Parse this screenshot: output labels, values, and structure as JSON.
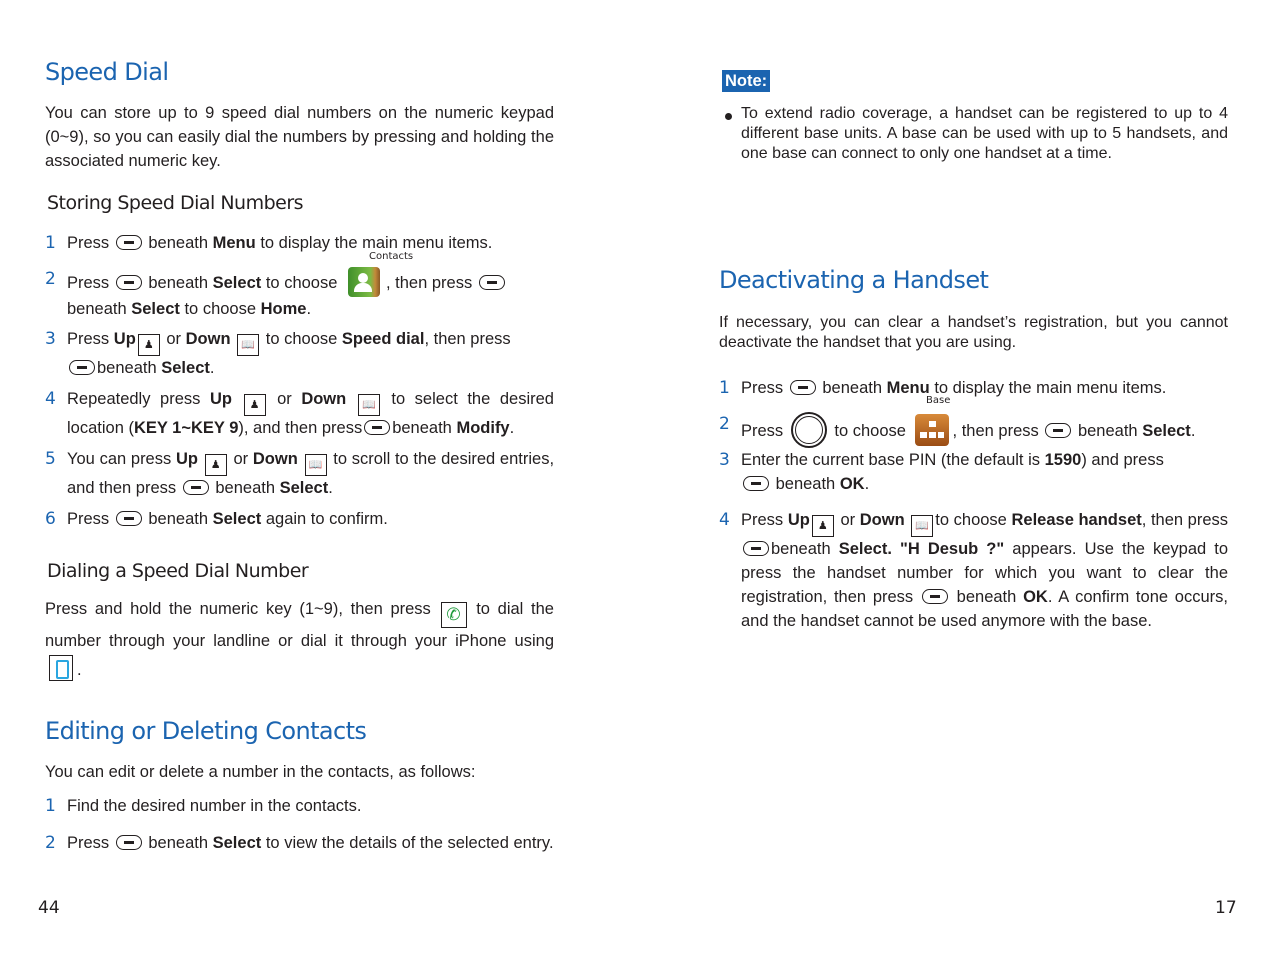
{
  "left_page": {
    "page_number": "44",
    "speed_dial": {
      "title": "Speed Dial",
      "intro": "You can store up to 9 speed dial numbers on the numeric keypad (0~9), so you can easily dial the numbers by pressing and holding the associated numeric key."
    },
    "storing": {
      "title": "Storing Speed Dial Numbers",
      "steps": [
        {
          "n": "1",
          "parts": [
            "Press",
            "beneath",
            "Menu",
            "to display the main menu items."
          ]
        },
        {
          "n": "2",
          "parts": [
            "Press",
            "beneath",
            "Select",
            "to choose",
            ", then press",
            "beneath",
            "Select",
            "to choose",
            "Home",
            "."
          ],
          "icon_caption": "Contacts"
        },
        {
          "n": "3",
          "parts": [
            "Press",
            "Up",
            "or",
            "Down",
            "to choose",
            "Speed dial",
            ", then press",
            "beneath",
            "Select",
            "."
          ]
        },
        {
          "n": "4",
          "parts": [
            "Repeatedly press",
            "Up",
            "or",
            "Down",
            "to select the desired location (",
            "KEY 1~KEY 9",
            "), and then press",
            "beneath",
            "Modify",
            "."
          ]
        },
        {
          "n": "5",
          "parts": [
            "You can press",
            "Up",
            "or",
            "Down",
            "to scroll to the desired entries, and then press",
            "beneath",
            "Select",
            "."
          ]
        },
        {
          "n": "6",
          "parts": [
            "Press",
            "beneath",
            "Select",
            "again to confirm."
          ]
        }
      ]
    },
    "dialing": {
      "title": "Dialing a Speed Dial Number",
      "parts": [
        "Press and hold the numeric key (1~9), then press",
        "to dial the number through your landline or dial it through your iPhone using",
        "."
      ]
    },
    "editing": {
      "title": "Editing or Deleting Contacts",
      "intro": "You can edit or delete a number in the contacts, as follows:",
      "steps": [
        {
          "n": "1",
          "parts": [
            "Find the desired number in the contacts."
          ]
        },
        {
          "n": "2",
          "parts": [
            "Press",
            "beneath",
            "Select",
            "to view the details of the selected entry."
          ]
        }
      ]
    }
  },
  "right_page": {
    "page_number": "17",
    "note": {
      "label": "Note:",
      "text": "To extend radio coverage, a handset can be registered to up to 4 different base units. A base can be used with up to 5 handsets, and one base can connect to only one handset at a time."
    },
    "deactivating": {
      "title": "Deactivating a Handset",
      "intro": "If necessary, you can clear a handset’s registration, but you cannot deactivate the handset that you are using.",
      "steps": [
        {
          "n": "1",
          "parts": [
            "Press",
            "beneath",
            "Menu",
            "to display the main menu items."
          ]
        },
        {
          "n": "2",
          "parts": [
            "Press",
            "to choose",
            ", then press",
            "beneath",
            "Select",
            "."
          ],
          "icon_caption": "Base"
        },
        {
          "n": "3",
          "parts": [
            "Enter the current base PIN (the default is",
            "1590",
            ") and press",
            "beneath",
            "OK",
            "."
          ]
        },
        {
          "n": "4",
          "parts": [
            "Press",
            "Up",
            "or",
            "Down",
            "to choose",
            "Release handset",
            ", then press",
            "beneath",
            "Select",
            ". \"H Desub ?\"",
            "appears. Use the keypad to press the handset number for which you want to clear the registration, then press",
            "beneath",
            "OK",
            ". A confirm tone occurs, and the handset cannot be used anymore with the base."
          ]
        }
      ]
    }
  },
  "icons": {
    "up_key": "contacts-up-key-icon",
    "down_key": "phonebook-down-key-icon",
    "soft_key": "soft-key-icon",
    "contacts_menu": "contacts-menu-icon",
    "base_menu": "base-menu-icon",
    "nav_key": "navigation-key-icon",
    "call_key": "landline-call-icon",
    "iphone_key": "iphone-call-icon"
  },
  "colors": {
    "heading": "#1b64b0",
    "note_badge": "#1b64b0",
    "text": "#231f20"
  }
}
